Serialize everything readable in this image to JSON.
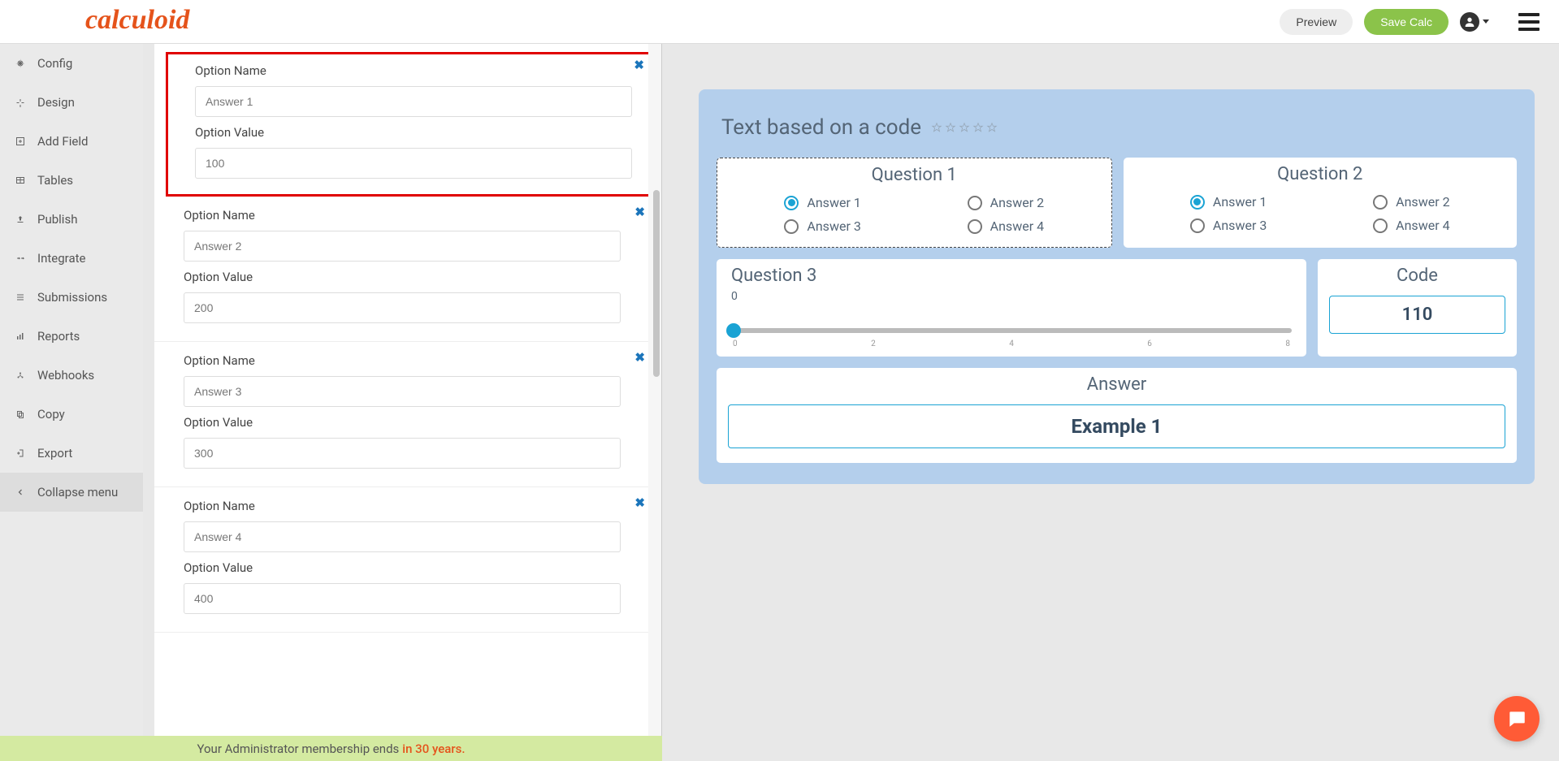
{
  "topbar": {
    "logo": "calculoid",
    "preview": "Preview",
    "save": "Save Calc"
  },
  "sidebar": {
    "items": [
      {
        "icon": "gear",
        "label": "Config"
      },
      {
        "icon": "design",
        "label": "Design"
      },
      {
        "icon": "plus",
        "label": "Add Field"
      },
      {
        "icon": "table",
        "label": "Tables"
      },
      {
        "icon": "upload",
        "label": "Publish"
      },
      {
        "icon": "integrate",
        "label": "Integrate"
      },
      {
        "icon": "list",
        "label": "Submissions"
      },
      {
        "icon": "bar",
        "label": "Reports"
      },
      {
        "icon": "webhook",
        "label": "Webhooks"
      },
      {
        "icon": "copy",
        "label": "Copy"
      },
      {
        "icon": "export",
        "label": "Export"
      },
      {
        "icon": "chevron-left",
        "label": "Collapse menu"
      }
    ]
  },
  "editor": {
    "optionNameLabel": "Option Name",
    "optionValueLabel": "Option Value",
    "options": [
      {
        "name": "Answer 1",
        "value": "100"
      },
      {
        "name": "Answer 2",
        "value": "200"
      },
      {
        "name": "Answer 3",
        "value": "300"
      },
      {
        "name": "Answer 4",
        "value": "400"
      }
    ]
  },
  "calc": {
    "title": "Text based on a code",
    "question1": {
      "title": "Question 1",
      "answers": [
        "Answer 1",
        "Answer 2",
        "Answer 3",
        "Answer 4"
      ],
      "checked": 0
    },
    "question2": {
      "title": "Question 2",
      "answers": [
        "Answer 1",
        "Answer 2",
        "Answer 3",
        "Answer 4"
      ],
      "checked": 0
    },
    "question3": {
      "title": "Question 3",
      "sliderValue": "0",
      "ticks": [
        "0",
        "2",
        "4",
        "6",
        "8"
      ]
    },
    "code": {
      "title": "Code",
      "value": "110"
    },
    "answer": {
      "title": "Answer",
      "value": "Example 1"
    }
  },
  "footer": {
    "text": "Your Administrator membership ends",
    "highlight": "in 30 years."
  }
}
